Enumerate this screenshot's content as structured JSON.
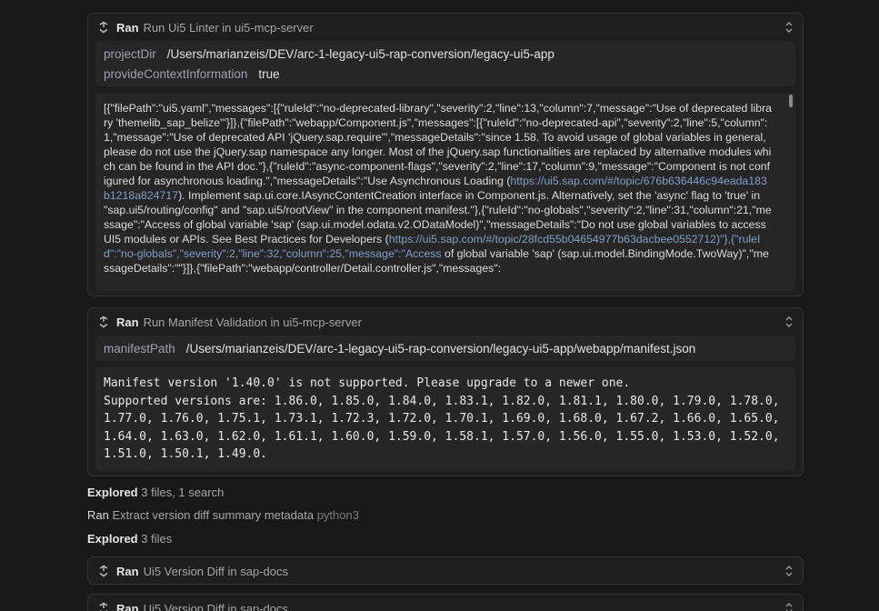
{
  "linter": {
    "ran": "Ran",
    "title": "Run Ui5 Linter in ui5-mcp-server",
    "params": [
      {
        "key": "projectDir",
        "value": "/Users/marianzeis/DEV/arc-1-legacy-ui5-rap-conversion/legacy-ui5-app"
      },
      {
        "key": "provideContextInformation",
        "value": "true"
      }
    ],
    "output": [
      "[{\"filePath\":\"ui5.yaml\",\"messages\":[{\"ruleId\":\"no-deprecated-library\",\"severity\":2,\"line\":13,\"column\":7,\"message\":\"Use of deprecated library 'themelib_sap_belize'\"}]},{\"filePath\":\"webapp/Component.js\",\"messages\":[{\"ruleId\":\"no-deprecated-api\",\"severity\":2,\"line\":5,\"column\":1,\"message\":\"Use of deprecated API 'jQuery.sap.require'\",\"messageDetails\":\"since 1.58. To avoid usage of global variables in general, please do not use the jQuery.sap namespace any longer. Most of the jQuery.sap functionalities are replaced by alternative modules which can be found in the API doc.\"},{\"ruleId\":\"async-component-flags\",\"severity\":2,\"line\":17,\"column\":9,\"message\":\"Component is not configured for asynchronous loading.\",\"messageDetails\":\"Use Asynchronous Loading (",
      "https://ui5.sap.com/#/topic/676b636446c94eada183b1218a824717",
      "). Implement sap.ui.core.IAsyncContentCreation interface in Component.js. Alternatively, set the 'async' flag to 'true' in \"sap.ui5/routing/config\" and \"sap.ui5/rootView\" in the component manifest.\"},{\"ruleId\":\"no-globals\",\"severity\":2,\"line\":31,\"column\":21,\"message\":\"Access of global variable 'sap' (sap.ui.model.odata.v2.ODataModel)\",\"messageDetails\":\"Do not use global variables to access UI5 modules or APIs. See Best Practices for Developers (",
      "https://ui5.sap.com/#/topic/28fcd55b04654977b63dacbee0552712)\"},{\"ruleId\":\"no-globals\",\"severity\":2,\"line\":32,\"column\":25,\"message\":\"Access",
      " of global variable 'sap' (sap.ui.model.BindingMode.TwoWay)\",\"messageDetails\":\"\"}]},{\"filePath\":\"webapp/controller/Detail.controller.js\",\"messages\":"
    ]
  },
  "manifest": {
    "ran": "Ran",
    "title": "Run Manifest Validation in ui5-mcp-server",
    "params": [
      {
        "key": "manifestPath",
        "value": "/Users/marianzeis/DEV/arc-1-legacy-ui5-rap-conversion/legacy-ui5-app/webapp/manifest.json"
      }
    ],
    "output": "Manifest version '1.40.0' is not supported. Please upgrade to a newer one.\nSupported versions are: 1.86.0, 1.85.0, 1.84.0, 1.83.1, 1.82.0, 1.81.1, 1.80.0, 1.79.0, 1.78.0, 1.77.0, 1.76.0, 1.75.1, 1.73.1, 1.72.3, 1.72.0, 1.70.1, 1.69.0, 1.68.0, 1.67.2, 1.66.0, 1.65.0, 1.64.0, 1.63.0, 1.62.0, 1.61.1, 1.60.0, 1.59.0, 1.58.1, 1.57.0, 1.56.0, 1.55.0, 1.53.0, 1.52.0, 1.51.0, 1.50.1, 1.49.0."
  },
  "activity": [
    {
      "verb": "Explored",
      "text": "3 files, 1 search",
      "suffix": ""
    },
    {
      "verb": "Ran",
      "text": "Extract version diff summary metadata",
      "suffix": "python3"
    },
    {
      "verb": "Explored",
      "text": "3 files",
      "suffix": ""
    }
  ],
  "diff1": {
    "ran": "Ran",
    "title": "Ui5 Version Diff in sap-docs"
  },
  "diff2": {
    "ran": "Ran",
    "title": "Ui5 Version Diff in sap-docs"
  },
  "icons": {
    "tool": "tool-icon",
    "chevron": "chevron-up-down-icon"
  }
}
